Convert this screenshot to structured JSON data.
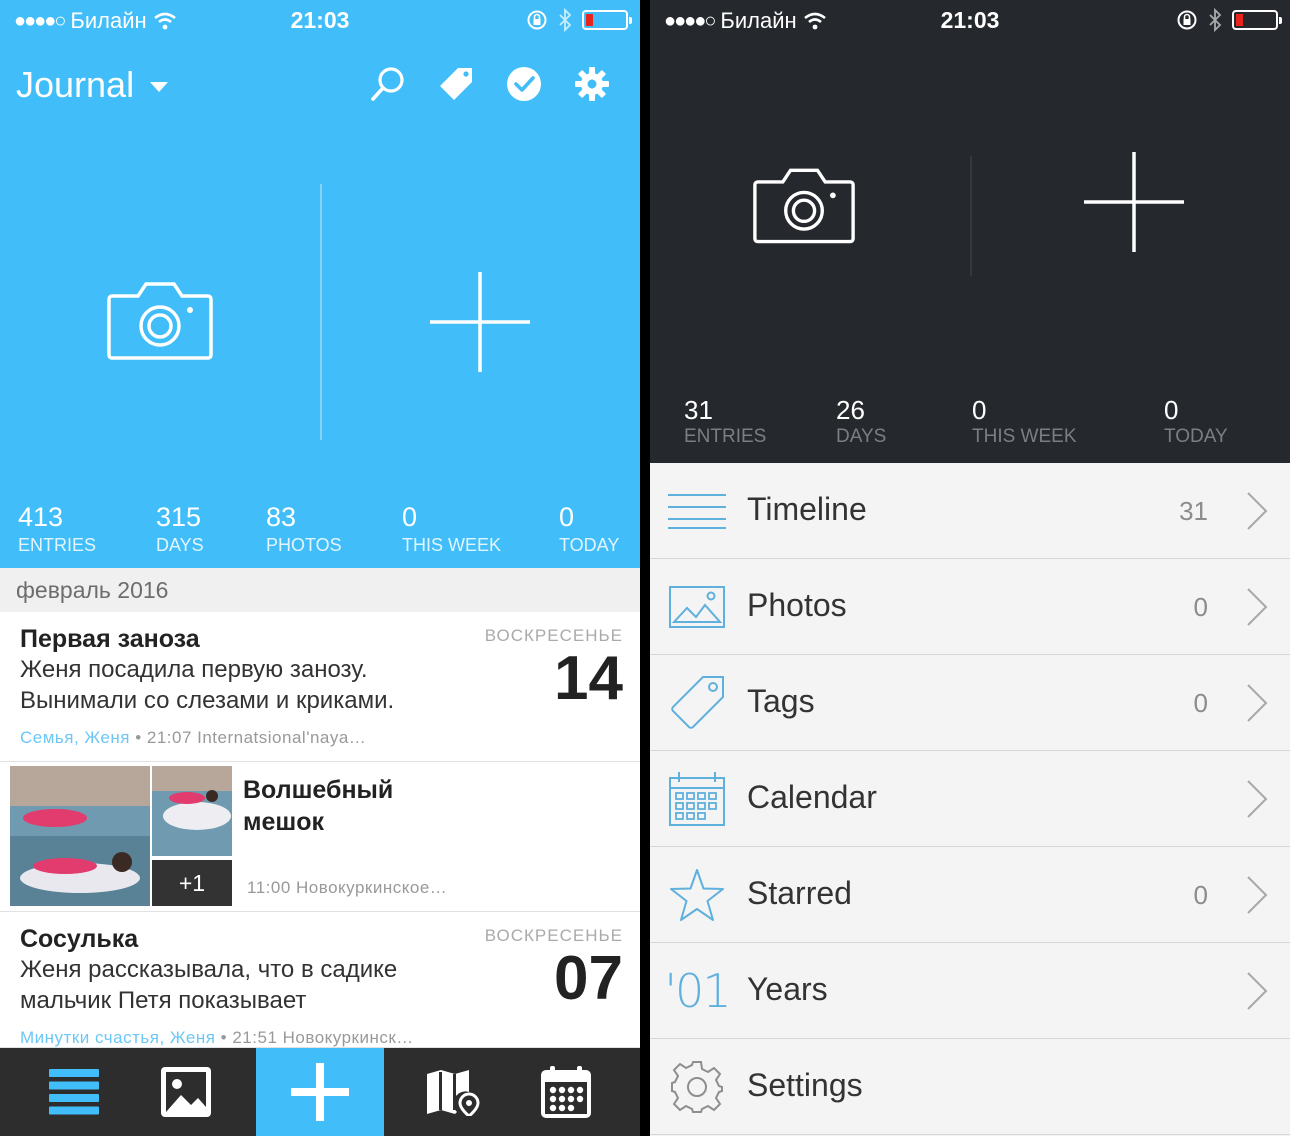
{
  "left": {
    "status": {
      "carrier": "Билайн",
      "time": "21:03"
    },
    "header": {
      "title": "Journal"
    },
    "stats": [
      {
        "value": "413",
        "label": "ENTRIES"
      },
      {
        "value": "315",
        "label": "DAYS"
      },
      {
        "value": "83",
        "label": "PHOTOS"
      },
      {
        "value": "0",
        "label": "THIS WEEK"
      },
      {
        "value": "0",
        "label": "TODAY"
      }
    ],
    "month": "февраль 2016",
    "entries": [
      {
        "title": "Первая заноза",
        "body": "Женя посадила первую занозу. Вынимали со слезами и криками.",
        "tags": "Семья, Женя",
        "meta": " • 21:07 Internatsional'naya…",
        "dow": "ВОСКРЕСЕНЬЕ",
        "day": "14"
      },
      {
        "title": "Волшебный мешок",
        "meta": "11:00 Новокуркинское…",
        "more": "+1"
      },
      {
        "title": "Сосулька",
        "body": "Женя рассказывала, что в садике мальчик Петя показывает",
        "tags": "Минутки счастья, Женя",
        "meta": " • 21:51 Новокуркинск…",
        "dow": "ВОСКРЕСЕНЬЕ",
        "day": "07"
      }
    ],
    "tabbar": [
      "timeline-tab",
      "photos-tab",
      "add-entry-tab",
      "map-tab",
      "calendar-tab"
    ],
    "colors": {
      "accent": "#41bef9",
      "tabbar": "#2d2d2d"
    }
  },
  "right": {
    "status": {
      "carrier": "Билайн",
      "time": "21:03"
    },
    "stats": [
      {
        "value": "31",
        "label": "ENTRIES"
      },
      {
        "value": "26",
        "label": "DAYS"
      },
      {
        "value": "0",
        "label": "THIS WEEK"
      },
      {
        "value": "0",
        "label": "TODAY"
      }
    ],
    "menu": [
      {
        "label": "Timeline",
        "count": "31",
        "icon": "lines-icon"
      },
      {
        "label": "Photos",
        "count": "0",
        "icon": "photo-icon"
      },
      {
        "label": "Tags",
        "count": "0",
        "icon": "tag-icon"
      },
      {
        "label": "Calendar",
        "count": "",
        "icon": "calendar-icon"
      },
      {
        "label": "Starred",
        "count": "0",
        "icon": "star-icon"
      },
      {
        "label": "Years",
        "count": "",
        "icon": "years-icon",
        "icon_text": "'01"
      },
      {
        "label": "Settings",
        "count": "",
        "icon": "gear-icon"
      }
    ],
    "colors": {
      "header": "#25282c",
      "icon": "#5fb0dd"
    }
  }
}
